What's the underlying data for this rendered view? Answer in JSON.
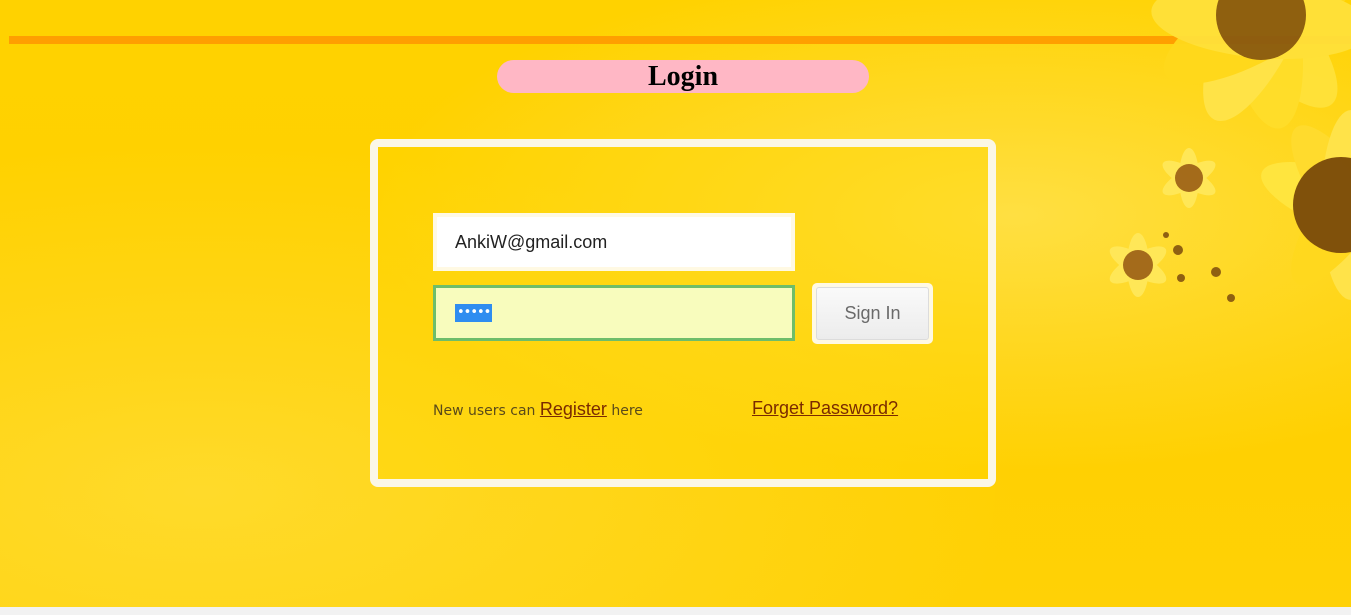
{
  "page": {
    "title": "Login"
  },
  "login_form": {
    "email_value": "AnkiW@gmail.com",
    "password_masked": "•••••",
    "signin_label": "Sign In",
    "register_prefix": "New users can",
    "register_link": "Register",
    "register_suffix": "here",
    "forget_link": "Forget Password?"
  },
  "colors": {
    "background": "#ffd200",
    "rule": "#ff9f00",
    "title_pill": "#ffb7c5",
    "password_bg": "#f8fcbd",
    "password_border": "#6ebd6a",
    "link": "#7a2a00"
  },
  "decor": {
    "image": "sunflower-image"
  }
}
